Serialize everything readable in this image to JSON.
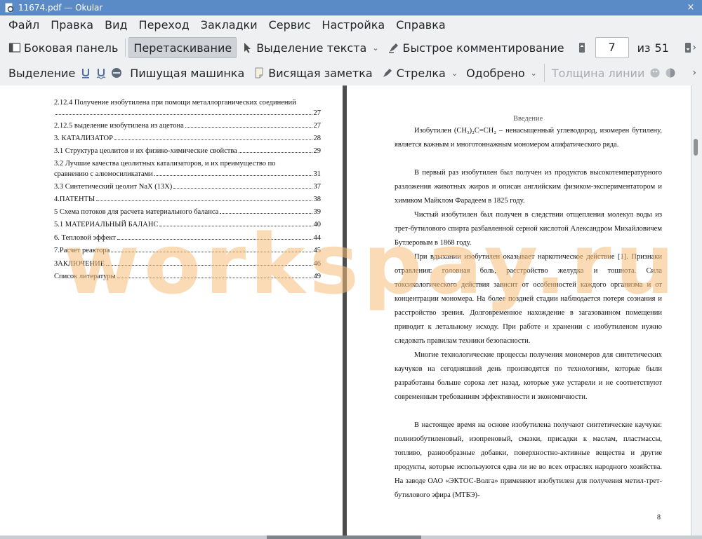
{
  "window": {
    "title": "11674.pdf — Okular",
    "icon": "okular-app-icon",
    "close_glyph": "×"
  },
  "menubar": {
    "items": [
      "Файл",
      "Правка",
      "Вид",
      "Переход",
      "Закладки",
      "Сервис",
      "Настройка",
      "Справка"
    ]
  },
  "toolbar1": {
    "sidebar_label": "Боковая панель",
    "drag_label": "Перетаскивание",
    "text_select_label": "Выделение текста",
    "quick_comment_label": "Быстрое комментирование",
    "current_page": "7",
    "of_label": "из",
    "total_pages": "51"
  },
  "toolbar2": {
    "selection_label": "Выделение",
    "typewriter_label": "Пишущая машинка",
    "sticky_note_label": "Висящая заметка",
    "arrow_label": "Стрелка",
    "stamp_label": "Одобрено",
    "line_width_label": "Толщина линии",
    "more_glyph": "›"
  },
  "left_page": {
    "toc": [
      {
        "text": "2.12.4 Получение изобутилена при помощи металлорганических соединений",
        "page": "27",
        "wrap": true
      },
      {
        "text": "2.12.5 выделение изобутилена из ацетона",
        "page": "27"
      },
      {
        "text": "3.    КАТАЛИЗАТОР",
        "page": "28"
      },
      {
        "text": "3.1 Структура цеолитов и их физико-химические свойства",
        "page": "29"
      },
      {
        "text_line1": "3.2 Лучшие качества цеолитных катализаторов, и их преимущество по",
        "text": "сравнению с алюмосиликатами",
        "page": "31"
      },
      {
        "text": "3.3 Синтетический цеолит NaX (13X)",
        "page": "37"
      },
      {
        "text": "4.ПАТЕНТЫ",
        "page": "38"
      },
      {
        "text": "5 Схема потоков для расчета материального баланса",
        "page": "39"
      },
      {
        "text": "5.1 МАТЕРИАЛЬНЫЙ БАЛАНС",
        "page": "40"
      },
      {
        "text": "6.    Тепловой эффект",
        "page": "44"
      },
      {
        "text": "7.Расчет реактора",
        "page": "45"
      },
      {
        "text": "ЗАКЛЮЧЕНИЕ",
        "page": "46"
      },
      {
        "text": "Список литературы",
        "page": "49"
      }
    ]
  },
  "right_page": {
    "heading": "Введение",
    "paragraphs": [
      "Изобутилен (СН₃)₂С=СН₂ – ненасыщенный углеводород, изомерен бутилену, является важным и многотоннажным мономером алифатического ряда.",
      "В первый раз изобутилен был получен из продуктов высокотемпературного разложения животных жиров и описан английским физиком-экспериментатором и химиком Майклом Фарадеем в 1825 году.",
      "Чистый изобутилен был получен в следствии отщепления молекул воды из трет-бутилового спирта разбавленной серной кислотой Александром Михайловичем Бутлеровым в 1868 году.",
      "При вдыхании изобутилен оказывает наркотическое действие [1]. Признаки отравления: головная боль, расстройство желудка и тошнота. Сила токсикологического действия зависит от особенностей каждого организма и от концентрации мономера. На более поздней стадии наблюдается потеря сознания и расстройство зрения. Долговременное нахождение в загазованном помещении приводит к летальному исходу. При работе и хранении с изобутиленом нужно следовать правилам техники безопасности.",
      "Многие технологические процессы получения мономеров для синтетических каучуков на сегодняшний день производятся по технологиям, которые были разработаны больше сорока лет назад, которые уже устарели и не соответствуют современным требованиям эффективности и экономичности.",
      "В настоящее время на основе изобутилена получают синтетические каучуки: полиизобутиленовый, изопреновый, смазки, присадки к маслам, пластмассы, топливо, разнообразные добавки, поверхностно-активные вещества и другие продукты, которые используются едва ли не во всех отраслях народного хозяйства. На заводе ОАО «ЭКТОС-Волга» применяют изобутилен для получения метил-трет-бутилового эфира (МТБЭ)-"
    ],
    "page_number": "8"
  },
  "watermark": "workspay.ru",
  "colors": {
    "titlebar": "#5a8bc6",
    "chrome": "#eff0f1",
    "watermark": "#f6be78"
  }
}
